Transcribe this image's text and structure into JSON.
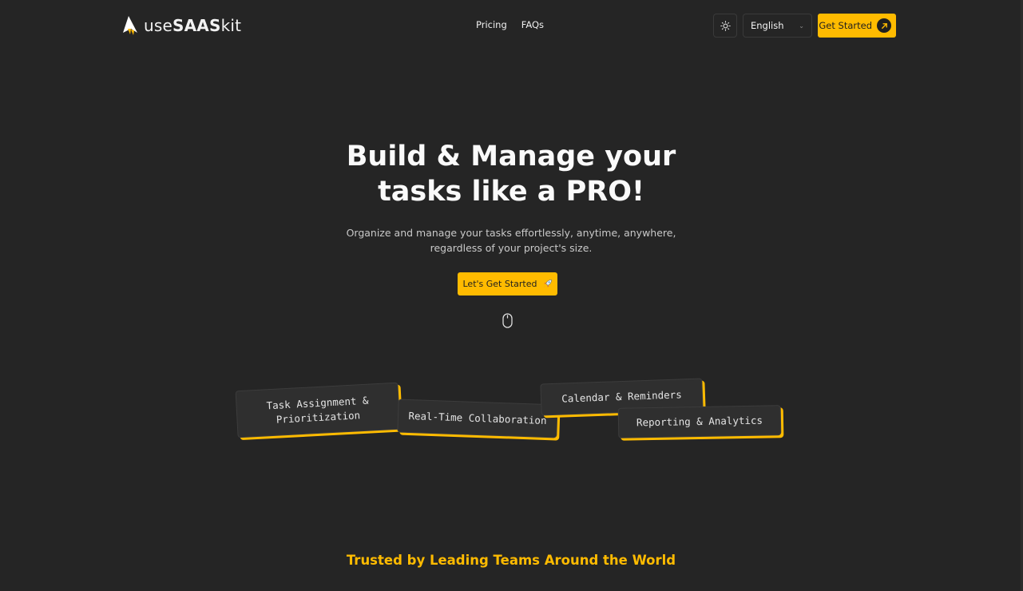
{
  "header": {
    "logo": {
      "prefix": "use",
      "bold": "SAAS",
      "suffix": "kit"
    },
    "nav": [
      {
        "label": "Pricing"
      },
      {
        "label": "FAQs"
      }
    ],
    "theme_toggle_icon": "sun-icon",
    "language": {
      "selected": "English"
    },
    "get_started_label": "Get Started"
  },
  "hero": {
    "title_line1": "Build & Manage your",
    "title_line2": "tasks like a PRO!",
    "subtitle": "Organize and manage your tasks effortlessly, anytime, anywhere, regardless of your project's size.",
    "cta_label": "Let's Get Started",
    "cta_icon": "rocket-icon",
    "scroll_icon": "mouse-icon"
  },
  "features": [
    {
      "label": "Task Assignment & Prioritization"
    },
    {
      "label": "Real-Time Collaboration"
    },
    {
      "label": "Calendar & Reminders"
    },
    {
      "label": "Reporting & Analytics"
    }
  ],
  "trusted": {
    "heading": "Trusted by Leading Teams Around the World"
  },
  "colors": {
    "background": "#252525",
    "accent": "#ffbb00",
    "text": "#ffffff",
    "muted": "#c9c9c9"
  }
}
